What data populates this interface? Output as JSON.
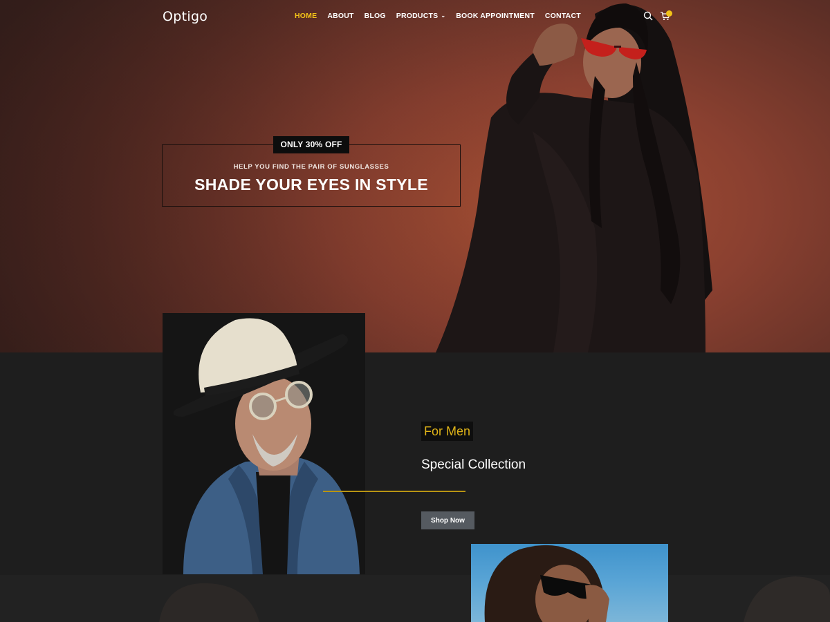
{
  "brand": {
    "logo": "Optigo"
  },
  "nav": {
    "items": [
      {
        "label": "HOME",
        "active": true
      },
      {
        "label": "ABOUT",
        "active": false
      },
      {
        "label": "BLOG",
        "active": false
      },
      {
        "label": "PRODUCTS",
        "active": false,
        "has_dropdown": true
      },
      {
        "label": "BOOK APPOINTMENT",
        "active": false
      },
      {
        "label": "CONTACT",
        "active": false
      }
    ],
    "icons": [
      "search-icon",
      "cart-icon"
    ]
  },
  "hero": {
    "tag": "ONLY 30% OFF",
    "subtitle": "HELP YOU FIND THE PAIR OF SUNGLASSES",
    "title": "SHADE YOUR EYES IN STYLE"
  },
  "collection": {
    "badge": "For Men",
    "title": "Special Collection",
    "button": "Shop Now"
  },
  "colors": {
    "accent": "#f2c318",
    "gold_line": "#b89412",
    "dark_bg": "#1e1e1e",
    "hero_bg": "#8a4030"
  }
}
